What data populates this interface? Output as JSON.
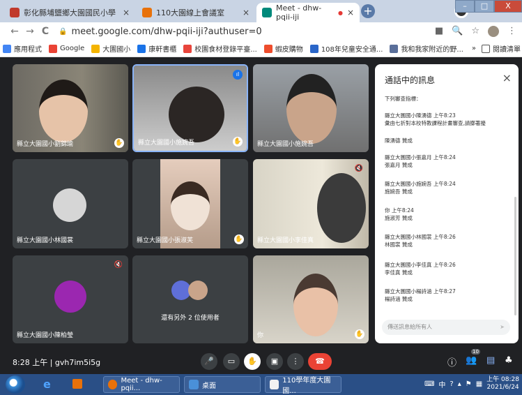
{
  "browser": {
    "tabs": [
      {
        "label": "彰化縣埔鹽鄉大園國民小學",
        "close": "×"
      },
      {
        "label": "110大園線上會議室",
        "close": "×"
      },
      {
        "label": "Meet - dhw-pqii-iji",
        "close": "×"
      }
    ],
    "new_tab": "+",
    "window_controls": {
      "minimize": "–",
      "maximize": "□",
      "close": "X"
    },
    "nav": {
      "back": "←",
      "forward": "→",
      "reload": "C"
    },
    "url": "meet.google.com/dhw-pqii-iji?authuser=0",
    "bookmarks": [
      {
        "label": "應用程式",
        "color": "#4285f4"
      },
      {
        "label": "Google",
        "color": "#ea4335"
      },
      {
        "label": "大園國小",
        "color": "#f4b400"
      },
      {
        "label": "康軒書櫃",
        "color": "#1a73e8"
      },
      {
        "label": "校園食材登錄平臺...",
        "color": "#e8453c"
      },
      {
        "label": "蝦皮購物",
        "color": "#ee4d2d"
      },
      {
        "label": "108年兒童安全通...",
        "color": "#2a66c9"
      },
      {
        "label": "我和我家附近的野...",
        "color": "#5a6f9a"
      }
    ],
    "bookmarks_more": "»",
    "reading_list": "閱讀清單"
  },
  "meet": {
    "tiles": [
      {
        "name": "縣立大園國小劉錦瑜",
        "kind": "video"
      },
      {
        "name": "縣立大園國小施婉吾",
        "kind": "video"
      },
      {
        "name": "縣立大園國小施婉吾",
        "kind": "video"
      },
      {
        "name": "縣立大園國小林國裳",
        "kind": "avatar"
      },
      {
        "name": "縣立大園國小張淑芙",
        "kind": "video"
      },
      {
        "name": "縣立大園國小李佳真",
        "kind": "video"
      },
      {
        "name": "縣立大園國小陳柏瑩",
        "kind": "avatar"
      },
      {
        "name": "還有另外 2 位使用者",
        "kind": "others"
      },
      {
        "name": "你",
        "kind": "video"
      }
    ]
  },
  "chat": {
    "title": "通話中的訊息",
    "close": "×",
    "messages": [
      {
        "sender": "",
        "time": "",
        "text": "下列審查指標："
      },
      {
        "sender": "縣立大園國小陳湧德",
        "time": "上午8:23",
        "text": "彙由七折對本校特教課程計畫審查,請擲著擾"
      },
      {
        "sender": "",
        "time": "",
        "text": "陳湧德 贊成"
      },
      {
        "sender": "縣立大園國小張嘉月",
        "time": "上午8:24",
        "text": "張嘉月 贊成"
      },
      {
        "sender": "縣立大園國小施婉吾",
        "time": "上午8:24",
        "text": "施婉吾 贊成"
      },
      {
        "sender": "你",
        "time": "上午8:24",
        "text": "施淑芳 贊成"
      },
      {
        "sender": "縣立大園國小林國裳",
        "time": "上午8:26",
        "text": "林國裳 贊成"
      },
      {
        "sender": "縣立大園國小李佳真",
        "time": "上午8:26",
        "text": "李佳真 贊成"
      },
      {
        "sender": "縣立大園國小楊詩涵",
        "time": "上午8:27",
        "text": "楊詩涵 贊成"
      }
    ],
    "input_placeholder": "傳送訊息給所有人",
    "send": "➤"
  },
  "controls": {
    "meeting_info": "8:28 上午 | gvh7im5i5g",
    "mic": "🎤",
    "camera": "▭",
    "raise_hand": "✋",
    "present": "▣",
    "more": "⋮",
    "end_call": "☎",
    "info": "ⓘ",
    "people": "👥",
    "people_count": "10",
    "chat": "▤",
    "activities": "♣"
  },
  "taskbar": {
    "items": [
      {
        "label": "Meet - dhw-pqii...",
        "color": "#e8710a"
      },
      {
        "label": "桌面",
        "color": "#4a90d9"
      },
      {
        "label": "110學年度大園國...",
        "color": "#f2f2f2"
      }
    ],
    "tray_lang": "中",
    "clock_time": "上午 08:28",
    "clock_date": "2021/6/24"
  }
}
